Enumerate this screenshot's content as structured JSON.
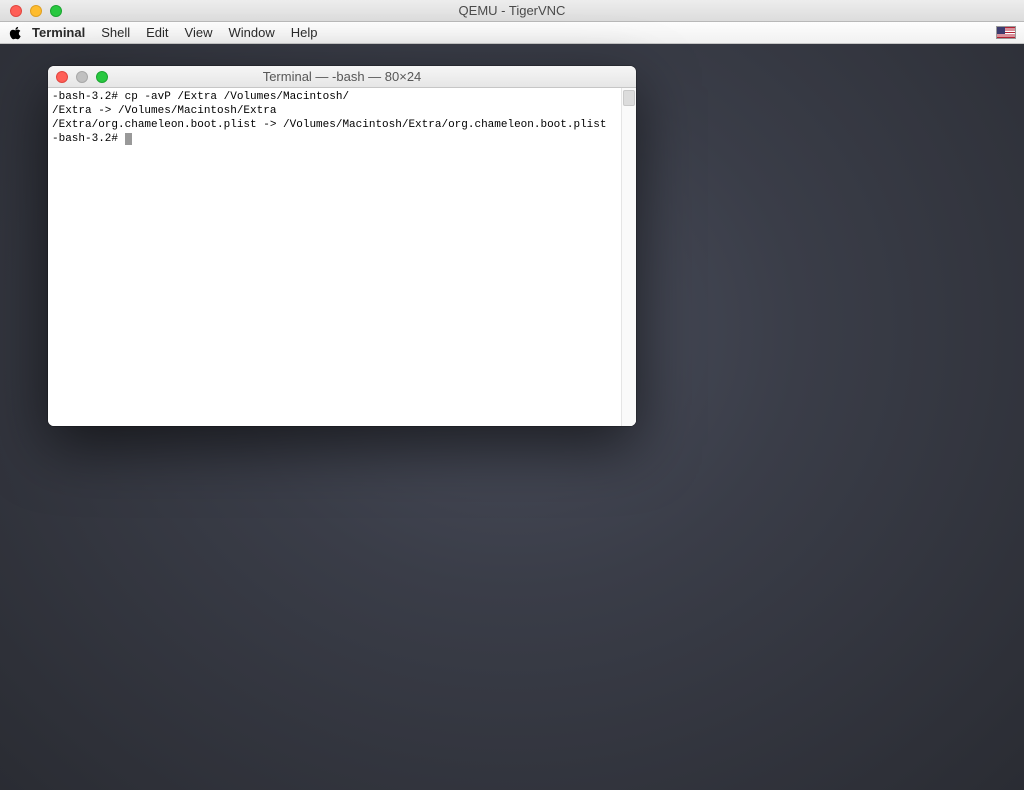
{
  "vnc": {
    "title": "QEMU - TigerVNC"
  },
  "menubar": {
    "app": "Terminal",
    "items": [
      "Shell",
      "Edit",
      "View",
      "Window",
      "Help"
    ]
  },
  "terminal": {
    "title": "Terminal — -bash — 80×24",
    "lines": [
      "-bash-3.2# cp -avP /Extra /Volumes/Macintosh/",
      "/Extra -> /Volumes/Macintosh/Extra",
      "/Extra/org.chameleon.boot.plist -> /Volumes/Macintosh/Extra/org.chameleon.boot.plist"
    ],
    "prompt": "-bash-3.2# "
  }
}
